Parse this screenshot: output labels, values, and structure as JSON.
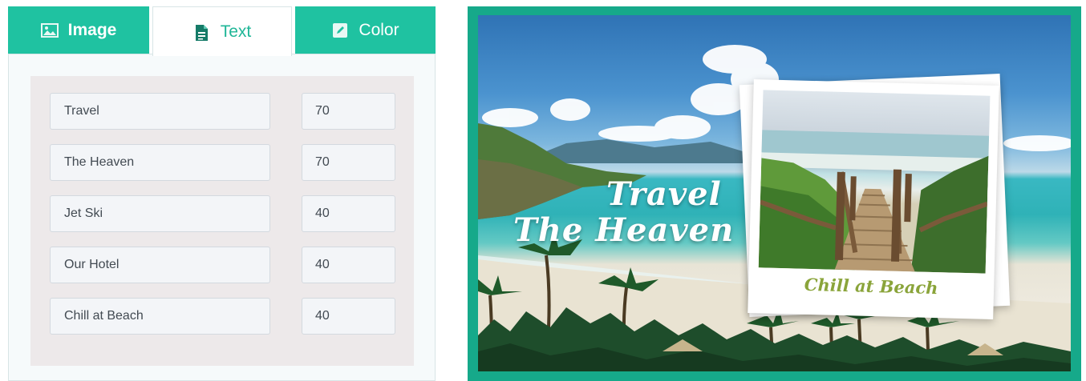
{
  "tabs": {
    "image": {
      "label": "Image",
      "icon": "image-icon"
    },
    "text": {
      "label": "Text",
      "icon": "document-icon"
    },
    "color": {
      "label": "Color",
      "icon": "edit-icon"
    }
  },
  "active_tab": "Text",
  "fields": [
    {
      "text": "Travel",
      "size": "70"
    },
    {
      "text": "The Heaven",
      "size": "70"
    },
    {
      "text": "Jet Ski",
      "size": "40"
    },
    {
      "text": "Our Hotel",
      "size": "40"
    },
    {
      "text": "Chill at Beach",
      "size": "40"
    }
  ],
  "preview": {
    "title_line_1": "Travel",
    "title_line_2": "The Heaven",
    "caption": "Chill at Beach"
  },
  "colors": {
    "accent": "#1fc2a1",
    "frame": "#16a98a",
    "caption": "#8aa43a"
  }
}
